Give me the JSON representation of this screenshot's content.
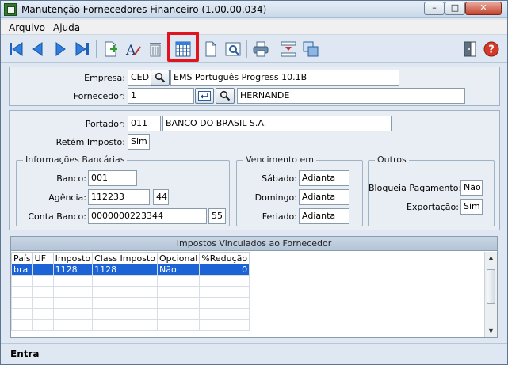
{
  "window": {
    "title": "Manutenção Fornecedores Financeiro (1.00.00.034)",
    "min_symbol": "–",
    "max_symbol": "□",
    "close_symbol": "✕"
  },
  "menu": {
    "arquivo": "Arquivo",
    "ajuda": "Ajuda"
  },
  "toolbar": {
    "icons": [
      "first-icon",
      "previous-icon",
      "next-icon",
      "last-icon",
      "add-icon",
      "edit-icon",
      "delete-icon",
      "calendar-grid-icon",
      "document-icon",
      "preview-icon",
      "print-icon",
      "transfer-icon",
      "copy-icon",
      "exit-door-icon",
      "help-icon"
    ],
    "highlight_color": "#e0141e"
  },
  "header": {
    "empresa_label": "Empresa:",
    "empresa_code": "CED",
    "empresa_name": "EMS Português Progress 10.1B",
    "fornecedor_label": "Fornecedor:",
    "fornecedor_code": "1",
    "fornecedor_name": "HERNANDE"
  },
  "details": {
    "portador_label": "Portador:",
    "portador_code": "011",
    "portador_name": "BANCO DO BRASIL S.A.",
    "retem_label": "Retém Imposto:",
    "retem_value": "Sim"
  },
  "bancarias": {
    "legend": "Informações Bancárias",
    "banco_label": "Banco:",
    "banco_value": "001",
    "agencia_label": "Agência:",
    "agencia_value": "112233",
    "agencia_dv": "44",
    "conta_label": "Conta Banco:",
    "conta_value": "0000000223344",
    "conta_dv": "55"
  },
  "vencimento": {
    "legend": "Vencimento em",
    "sabado_label": "Sábado:",
    "sabado_value": "Adianta",
    "domingo_label": "Domingo:",
    "domingo_value": "Adianta",
    "feriado_label": "Feriado:",
    "feriado_value": "Adianta"
  },
  "outros": {
    "legend": "Outros",
    "bloqueia_label": "Bloqueia Pagamento:",
    "bloqueia_value": "Não",
    "exportacao_label": "Exportação:",
    "exportacao_value": "Sim"
  },
  "grid": {
    "title": "Impostos Vinculados ao Fornecedor",
    "columns": [
      "País",
      "UF",
      "Imposto",
      "Class Imposto",
      "Opcional",
      "%Redução"
    ],
    "rows": [
      [
        "bra",
        "",
        "1128",
        "1128",
        "Não",
        "0"
      ]
    ]
  },
  "status": {
    "text": "Entra"
  }
}
